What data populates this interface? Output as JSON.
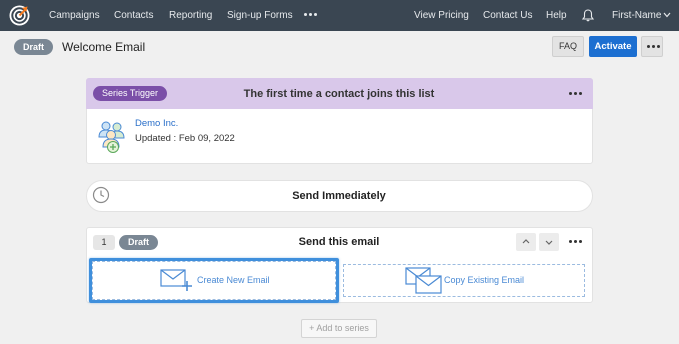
{
  "nav": {
    "items": [
      "Campaigns",
      "Contacts",
      "Reporting",
      "Sign-up Forms"
    ],
    "right_items": [
      "View Pricing",
      "Contact Us",
      "Help"
    ],
    "user": "First-Name"
  },
  "header": {
    "status": "Draft",
    "title": "Welcome Email",
    "faq_label": "FAQ",
    "activate_label": "Activate"
  },
  "trigger": {
    "pill": "Series Trigger",
    "title": "The first time a contact joins this list",
    "list_name": "Demo Inc.",
    "updated": "Updated : Feb 09, 2022"
  },
  "timing": {
    "label": "Send Immediately"
  },
  "step": {
    "number": "1",
    "status": "Draft",
    "title": "Send this email",
    "create_label": "Create New Email",
    "copy_label": "Copy Existing Email"
  },
  "add_series_label": "+ Add to series",
  "colors": {
    "nav_bg": "#3a4652",
    "accent": "#1c6fd1",
    "trigger_band": "#d9c8ea",
    "trigger_pill": "#7b4fa8",
    "draft_pill": "#7a8794",
    "highlight": "#3f8fdc"
  }
}
